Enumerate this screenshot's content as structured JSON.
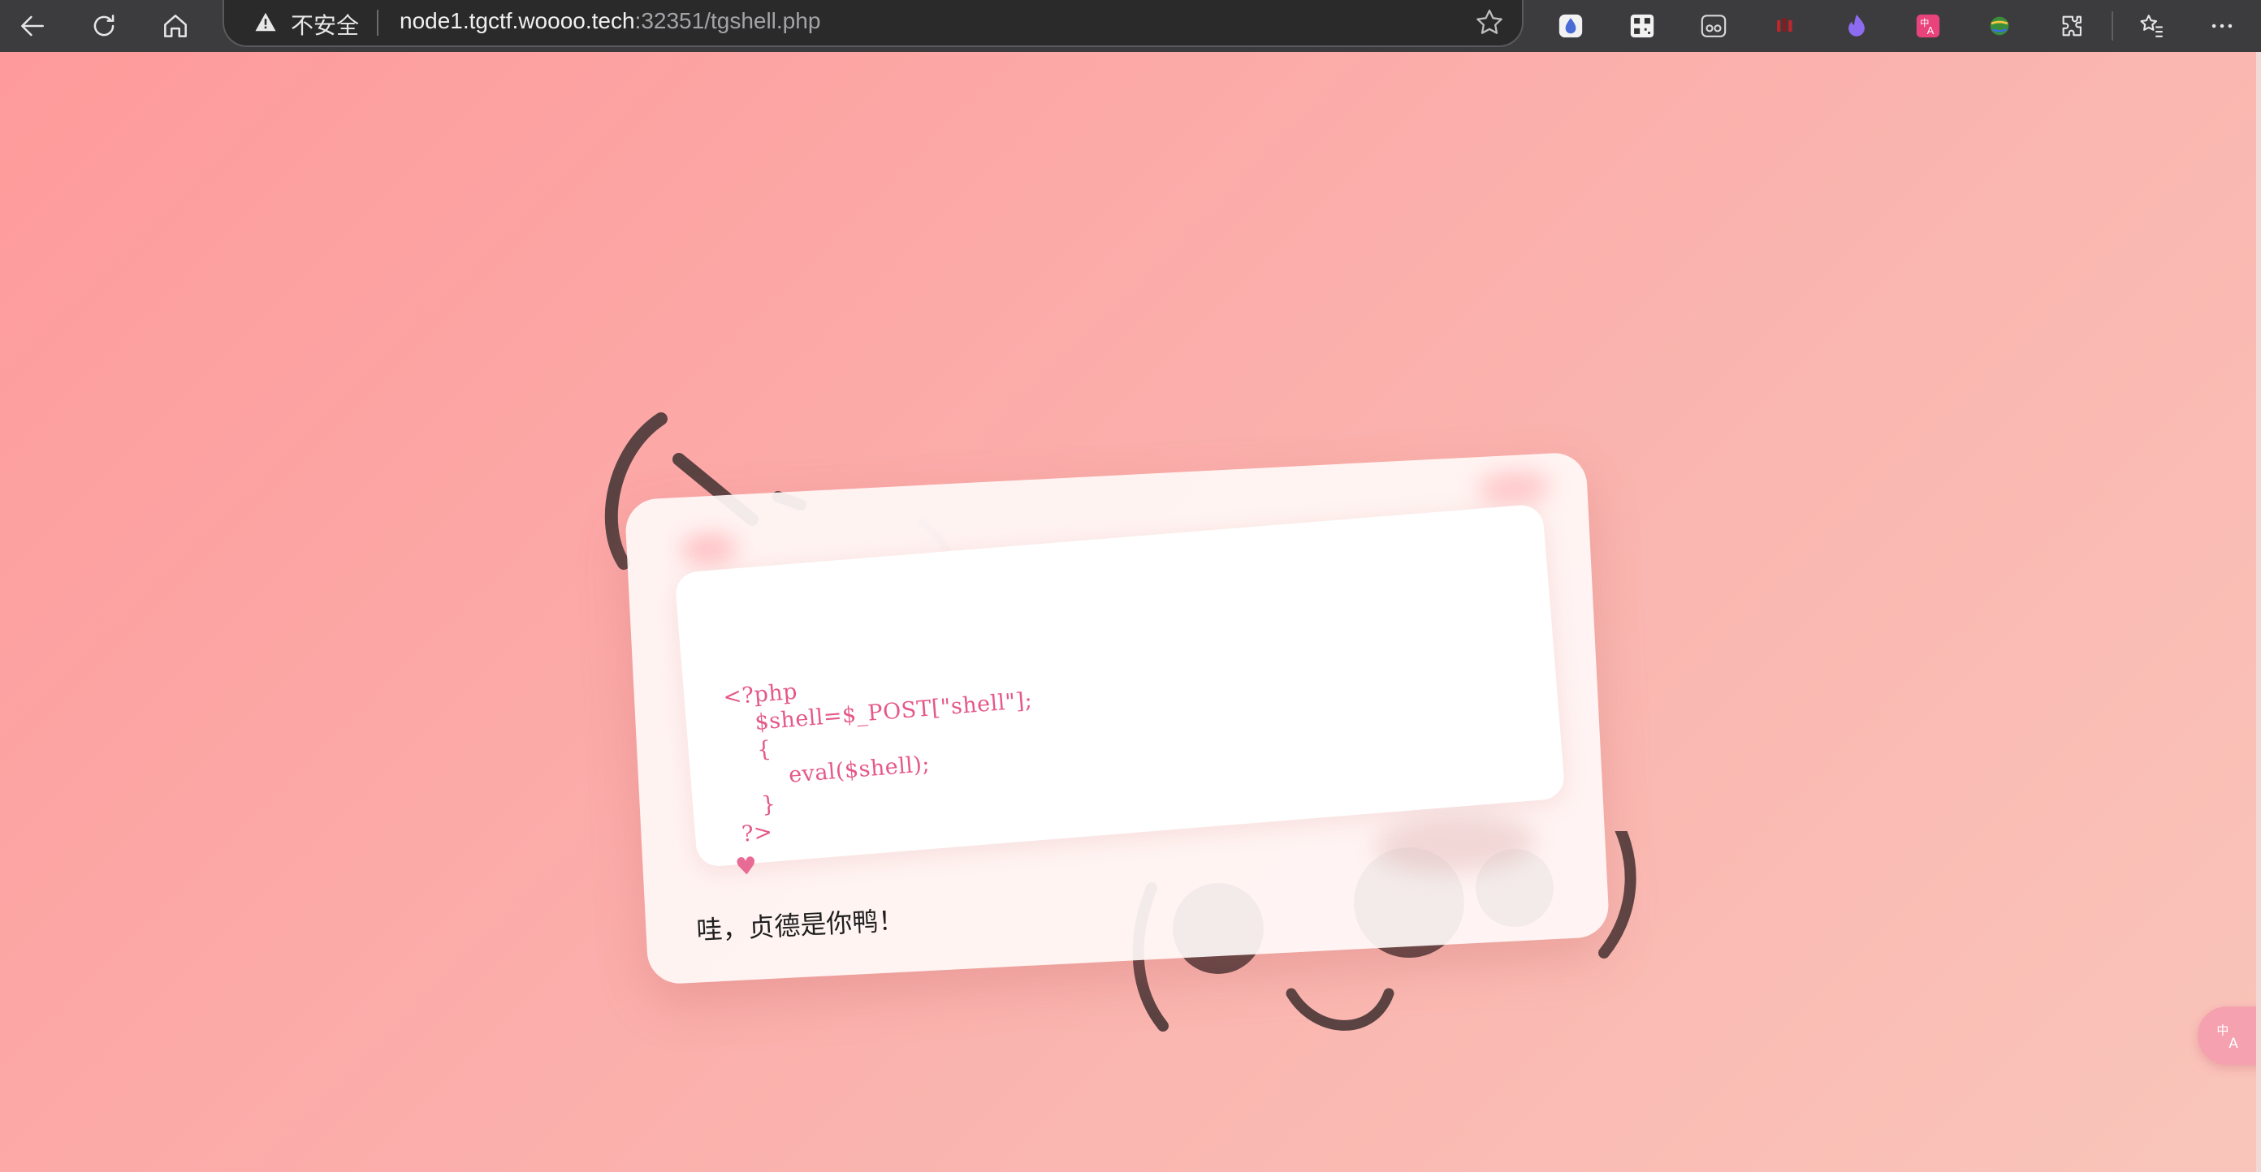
{
  "browser": {
    "security_label": "不安全",
    "url_host": "node1.tgctf.woooo.tech",
    "url_rest": ":32351/tgshell.php",
    "icons": [
      "back-icon",
      "refresh-icon",
      "home-icon",
      "warning-icon",
      "star-icon",
      "extension-icon",
      "favorites-icon",
      "more-icon"
    ]
  },
  "card": {
    "code_lines": [
      "<?php",
      "    $shell=$_POST[\"shell\"];",
      "    {",
      "        eval($shell);",
      "    }",
      " ?>"
    ],
    "heart": "♥",
    "caption": "哇，贞德是你鸭！"
  },
  "colors": {
    "background_start": "#fe9a9b",
    "background_end": "#f9c5ba",
    "code_color": "#e5588a",
    "kaomoji_color": "#5a4342"
  }
}
